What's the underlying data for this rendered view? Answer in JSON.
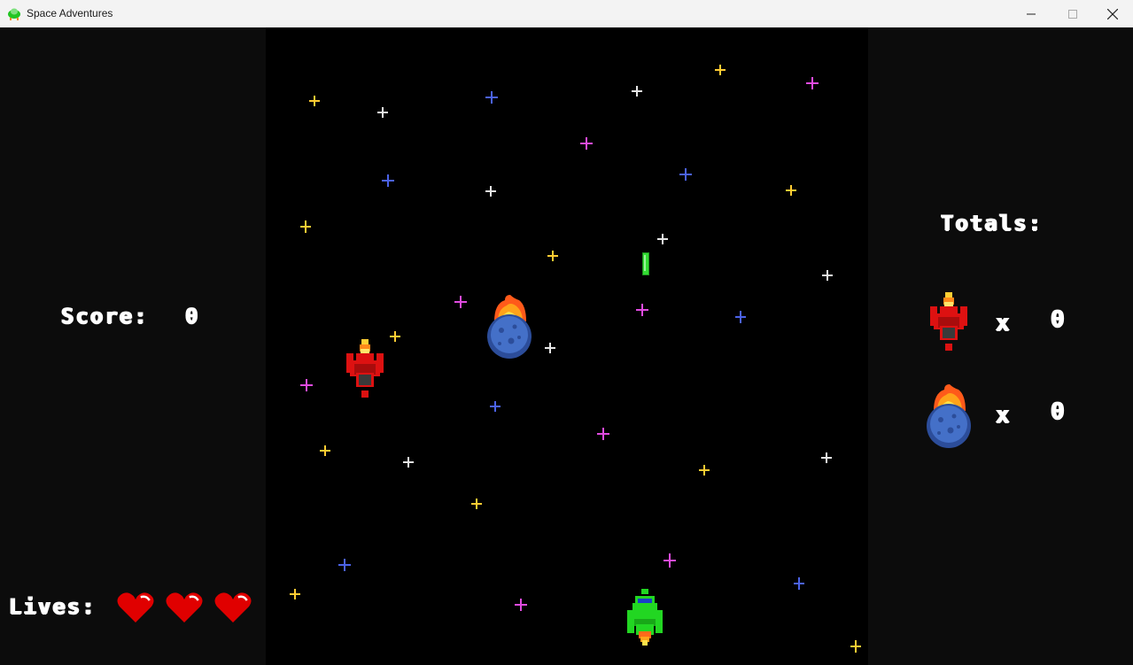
{
  "window": {
    "title": "Space Adventures",
    "icon": "green-ship-icon",
    "controls": [
      "minimize-icon",
      "maximize-icon",
      "close-icon"
    ]
  },
  "hud": {
    "score_label": "Score:",
    "score_value": "0",
    "lives_label": "Lives:",
    "lives": 3,
    "totals_label": "Totals:",
    "totals": [
      {
        "icon": "red-enemy-ship-icon",
        "times": "x",
        "count": "0"
      },
      {
        "icon": "flaming-asteroid-icon",
        "times": "x",
        "count": "0"
      }
    ]
  },
  "colors": {
    "background": "#000000",
    "side_panel": "#0c0c0c",
    "heart": "#e00000",
    "player": "#22d622",
    "enemy": "#dd1111",
    "asteroid": "#3b5fb0",
    "laser": "#33dd33",
    "star_yellow": "#ffcc33",
    "star_white": "#e6e6e6",
    "star_blue": "#4b62e8",
    "star_magenta": "#e04be0"
  }
}
